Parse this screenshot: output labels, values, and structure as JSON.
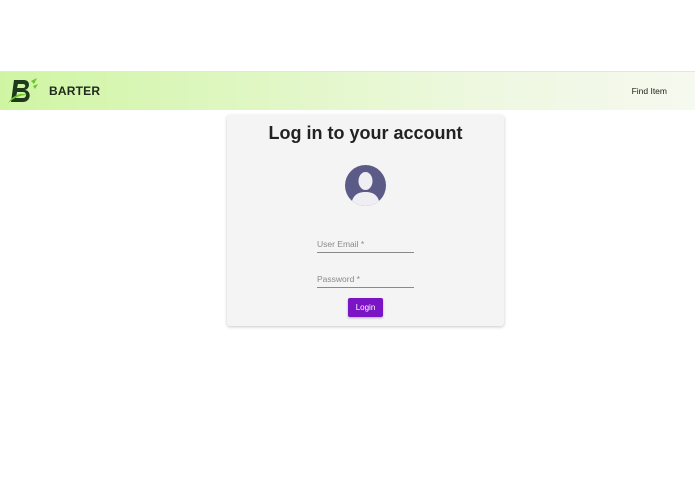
{
  "header": {
    "brand": "BARTER",
    "nav": [
      {
        "label": "Find Item"
      }
    ],
    "logo_icon": "barter-logo-icon",
    "colors": {
      "bar_start": "#cff5a3",
      "bar_end": "#f6f9ef",
      "logo_green": "#6cc52a",
      "logo_dark": "#1f3a1a"
    }
  },
  "login": {
    "title": "Log in to your account",
    "avatar_icon": "user-avatar-icon",
    "email": {
      "value": "",
      "placeholder": "User Email *"
    },
    "password": {
      "value": "",
      "placeholder": "Password *"
    },
    "submit_label": "Login",
    "accent": "#7b14c4"
  }
}
